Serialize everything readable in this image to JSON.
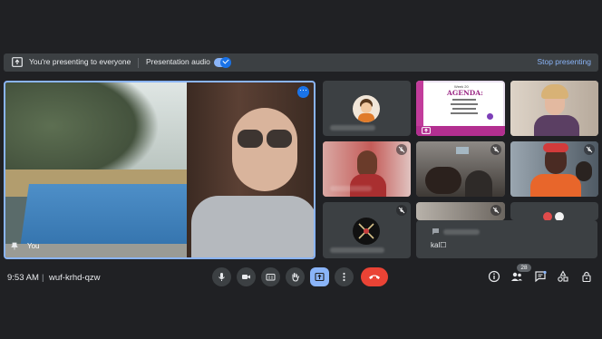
{
  "banner": {
    "presenting_text": "You're presenting to everyone",
    "presentation_audio_label": "Presentation audio",
    "presentation_audio_on": true,
    "stop_label": "Stop presenting"
  },
  "main_tile": {
    "self_label": "You",
    "more_options_label": "⋯"
  },
  "agenda_slide": {
    "heading_line": "Week 20",
    "title": "AGENDA:"
  },
  "chat_toast": {
    "message": "kal☐"
  },
  "toolbar": {
    "time": "9:53 AM",
    "divider": "|",
    "meeting_code": "wuf-krhd-qzw",
    "participants_count": "28"
  },
  "icons": {
    "mic": "microphone-icon",
    "camera": "camera-icon",
    "captions": "captions-icon",
    "hand": "raise-hand-icon",
    "present": "present-screen-icon",
    "more": "more-vert-icon",
    "hangup": "hang-up-icon",
    "info": "info-icon",
    "people": "people-icon",
    "chat": "chat-icon",
    "activities": "activities-icon",
    "host": "host-controls-icon"
  },
  "colors": {
    "background": "#202124",
    "accent": "#8ab4f8",
    "hangup": "#ea4335"
  }
}
